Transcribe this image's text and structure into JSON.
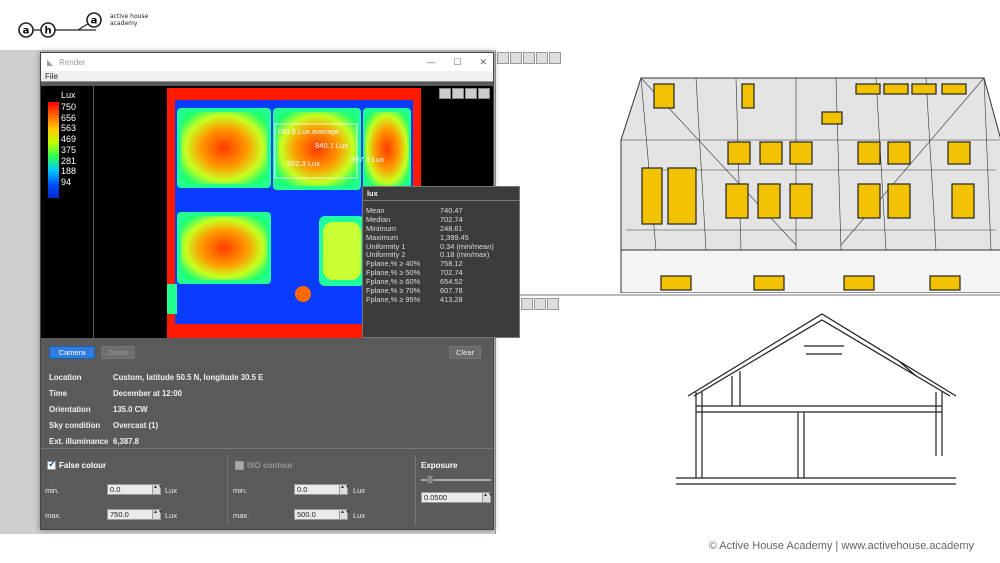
{
  "brand": {
    "logo_letters": [
      "a",
      "h",
      "a"
    ],
    "name_line1": "active house",
    "name_line2": "academy"
  },
  "footer": "© Active House Academy | www.activehouse.academy",
  "window": {
    "title": "Render",
    "menu": [
      "File"
    ]
  },
  "legend": {
    "unit": "Lux",
    "values": [
      "750",
      "656",
      "563",
      "469",
      "375",
      "281",
      "188",
      "94"
    ]
  },
  "annotations": [
    "740.5 Lux average",
    "840.1 Lux",
    "502.3 Lux",
    "697.3 Lux"
  ],
  "stats": {
    "title": "lux",
    "rows": [
      {
        "k": "Mean",
        "v": "740.47"
      },
      {
        "k": "Median",
        "v": "702.74"
      },
      {
        "k": "Minimum",
        "v": "248.61"
      },
      {
        "k": "Maximum",
        "v": "1,399.45"
      },
      {
        "k": "Uniformity 1",
        "v": "0.34 (min/mean)"
      },
      {
        "k": "Uniformity 2",
        "v": "0.18 (min/max)"
      },
      {
        "k": "Fplane,% ≥ 40%",
        "v": "758.12"
      },
      {
        "k": "Fplane,% ≥ 50%",
        "v": "702.74"
      },
      {
        "k": "Fplane,% ≥ 60%",
        "v": "654.52"
      },
      {
        "k": "Fplane,% ≥ 70%",
        "v": "607.78"
      },
      {
        "k": "Fplane,% ≥ 95%",
        "v": "413.28"
      }
    ]
  },
  "buttons": {
    "camera": "Camera",
    "zones": "Zones",
    "clear": "Clear"
  },
  "info": [
    {
      "k": "Location",
      "v": "Custom, latitude 50.5 N, longitude 30.5 E"
    },
    {
      "k": "Time",
      "v": "December at 12:00"
    },
    {
      "k": "Orientation",
      "v": "135.0 CW"
    },
    {
      "k": "Sky condition",
      "v": "Overcast (1)"
    },
    {
      "k": "Ext. illuminance",
      "v": "6,387.8"
    }
  ],
  "false_colour": {
    "label": "False colour",
    "checked": true,
    "min_label": "min.",
    "min": "0.0",
    "max_label": "max.",
    "max": "750.0",
    "unit": "Lux"
  },
  "iso_contour": {
    "label": "ISO contour",
    "checked": false,
    "min_label": "min.",
    "min": "0.0",
    "max_label": "max.",
    "max": "500.0",
    "unit": "Lux"
  },
  "exposure": {
    "label": "Exposure",
    "value": "0.0500",
    "level": 0.05
  }
}
